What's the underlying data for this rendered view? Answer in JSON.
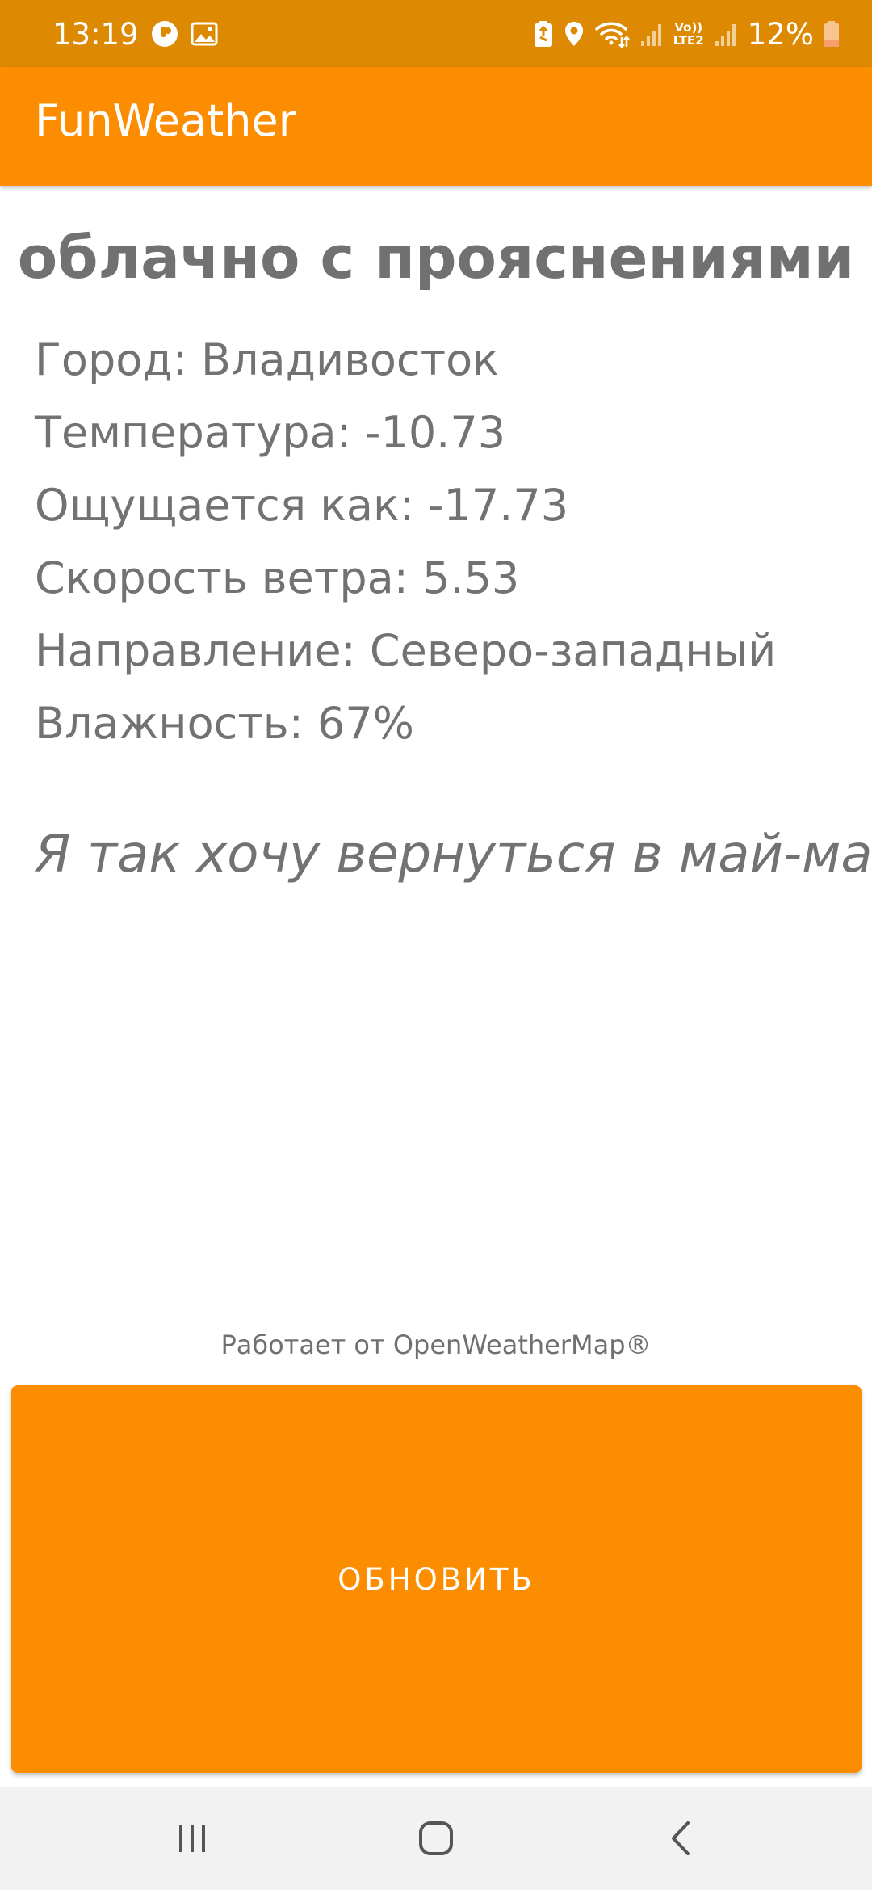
{
  "status_bar": {
    "time": "13:19",
    "battery_percent": "12%",
    "network_label_top": "Vo))",
    "network_label_bottom": "LTE2",
    "left_icons": [
      "messenger-icon",
      "gallery-icon"
    ],
    "right_icons": [
      "battery-saver-icon",
      "location-icon",
      "wifi-icon",
      "signal-icon",
      "signal-icon",
      "battery-icon"
    ]
  },
  "app_bar": {
    "title": "FunWeather"
  },
  "weather": {
    "description": "облачно с прояснениями",
    "rows": [
      "Город: Владивосток",
      "Температура: -10.73",
      "Ощущается как: -17.73",
      "Скорость ветра: 5.53",
      "Направление: Северо-западный",
      "Влажность: 67%"
    ]
  },
  "quote": "Я так хочу вернуться в май-май",
  "attribution": "Работает от OpenWeatherMap®",
  "refresh_button": {
    "label": "ОБНОВИТЬ"
  },
  "nav_bar": {
    "icons": [
      "recents-icon",
      "home-icon",
      "back-icon"
    ]
  },
  "colors": {
    "status_bar": "#dd8a02",
    "accent": "#fd8d00",
    "text": "#717171",
    "nav_bar": "#f2f2f2",
    "battery_low": "#f4a070"
  }
}
